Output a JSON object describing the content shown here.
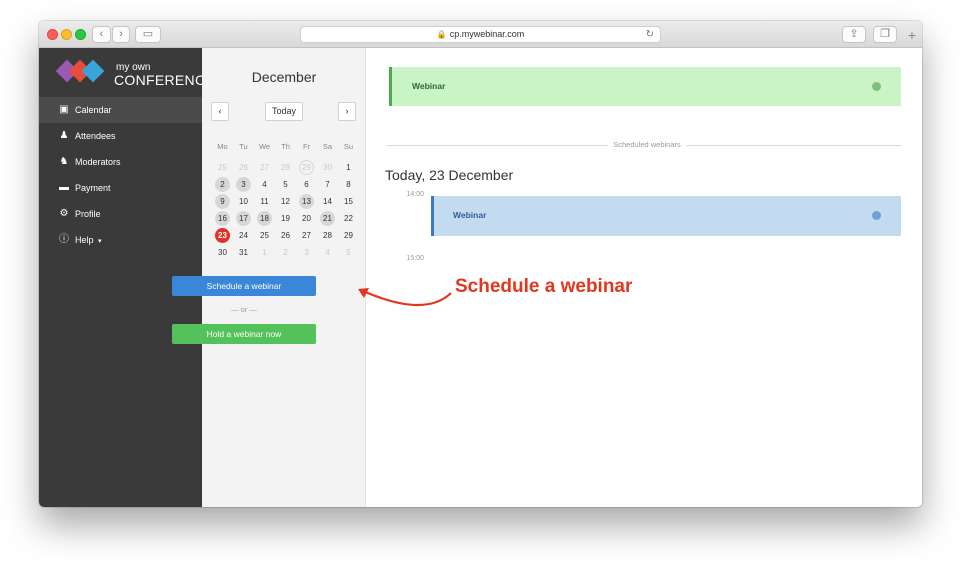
{
  "browser": {
    "url": "cp.mywebinar.com",
    "icons": [
      "back-icon",
      "forward-icon",
      "sidebar-toggle-icon",
      "lock-icon",
      "reload-icon",
      "share-icon",
      "tabs-icon",
      "new-tab-icon"
    ]
  },
  "logo": {
    "line1": "my own",
    "line2": "CONFERENCE",
    "colors": [
      "#9b59b6",
      "#e74c3c",
      "#3aa3d9"
    ]
  },
  "sidebar": {
    "items": [
      {
        "label": "Calendar",
        "icon": "calendar-icon",
        "active": true
      },
      {
        "label": "Attendees",
        "icon": "attendees-icon"
      },
      {
        "label": "Moderators",
        "icon": "moderators-icon"
      },
      {
        "label": "Payment",
        "icon": "card-icon"
      },
      {
        "label": "Profile",
        "icon": "gear-icon"
      },
      {
        "label": "Help",
        "icon": "info-icon"
      }
    ]
  },
  "calendar": {
    "month": "December",
    "today_label": "Today",
    "prev": "‹",
    "next": "›",
    "weekdays": [
      "Mo",
      "Tu",
      "We",
      "Th",
      "Fr",
      "Sa",
      "Su"
    ],
    "weeks": [
      [
        {
          "d": "25",
          "m": true
        },
        {
          "d": "26",
          "m": true
        },
        {
          "d": "27",
          "m": true
        },
        {
          "d": "28",
          "m": true
        },
        {
          "d": "29",
          "m": true,
          "o": true
        },
        {
          "d": "30",
          "m": true
        },
        {
          "d": "1"
        }
      ],
      [
        {
          "d": "2",
          "e": true
        },
        {
          "d": "3",
          "e": true
        },
        {
          "d": "4"
        },
        {
          "d": "5"
        },
        {
          "d": "6"
        },
        {
          "d": "7"
        },
        {
          "d": "8"
        }
      ],
      [
        {
          "d": "9",
          "e": true
        },
        {
          "d": "10"
        },
        {
          "d": "11"
        },
        {
          "d": "12"
        },
        {
          "d": "13",
          "e": true
        },
        {
          "d": "14"
        },
        {
          "d": "15"
        }
      ],
      [
        {
          "d": "16",
          "e": true
        },
        {
          "d": "17",
          "e": true
        },
        {
          "d": "18",
          "e": true
        },
        {
          "d": "19"
        },
        {
          "d": "20"
        },
        {
          "d": "21",
          "e": true
        },
        {
          "d": "22"
        }
      ],
      [
        {
          "d": "23",
          "t": true
        },
        {
          "d": "24"
        },
        {
          "d": "25"
        },
        {
          "d": "26"
        },
        {
          "d": "27"
        },
        {
          "d": "28"
        },
        {
          "d": "29"
        }
      ],
      [
        {
          "d": "30"
        },
        {
          "d": "31"
        },
        {
          "d": "1",
          "m": true
        },
        {
          "d": "2",
          "m": true
        },
        {
          "d": "3",
          "m": true
        },
        {
          "d": "4",
          "m": true
        },
        {
          "d": "5",
          "m": true
        }
      ]
    ],
    "schedule_button": "Schedule a webinar",
    "or_text": "— or —",
    "hold_button": "Hold a webinar now"
  },
  "main": {
    "banner_title": "Webinar",
    "banner_color": "#c8f4c6",
    "divider_label": "Scheduled webinars",
    "today_heading": "Today, 23 December",
    "times": [
      "14:00",
      "15:00"
    ],
    "event_title": "Webinar",
    "event_color": "#c3dbf1"
  },
  "annotation": {
    "text": "Schedule a webinar",
    "color": "#e2371f"
  }
}
